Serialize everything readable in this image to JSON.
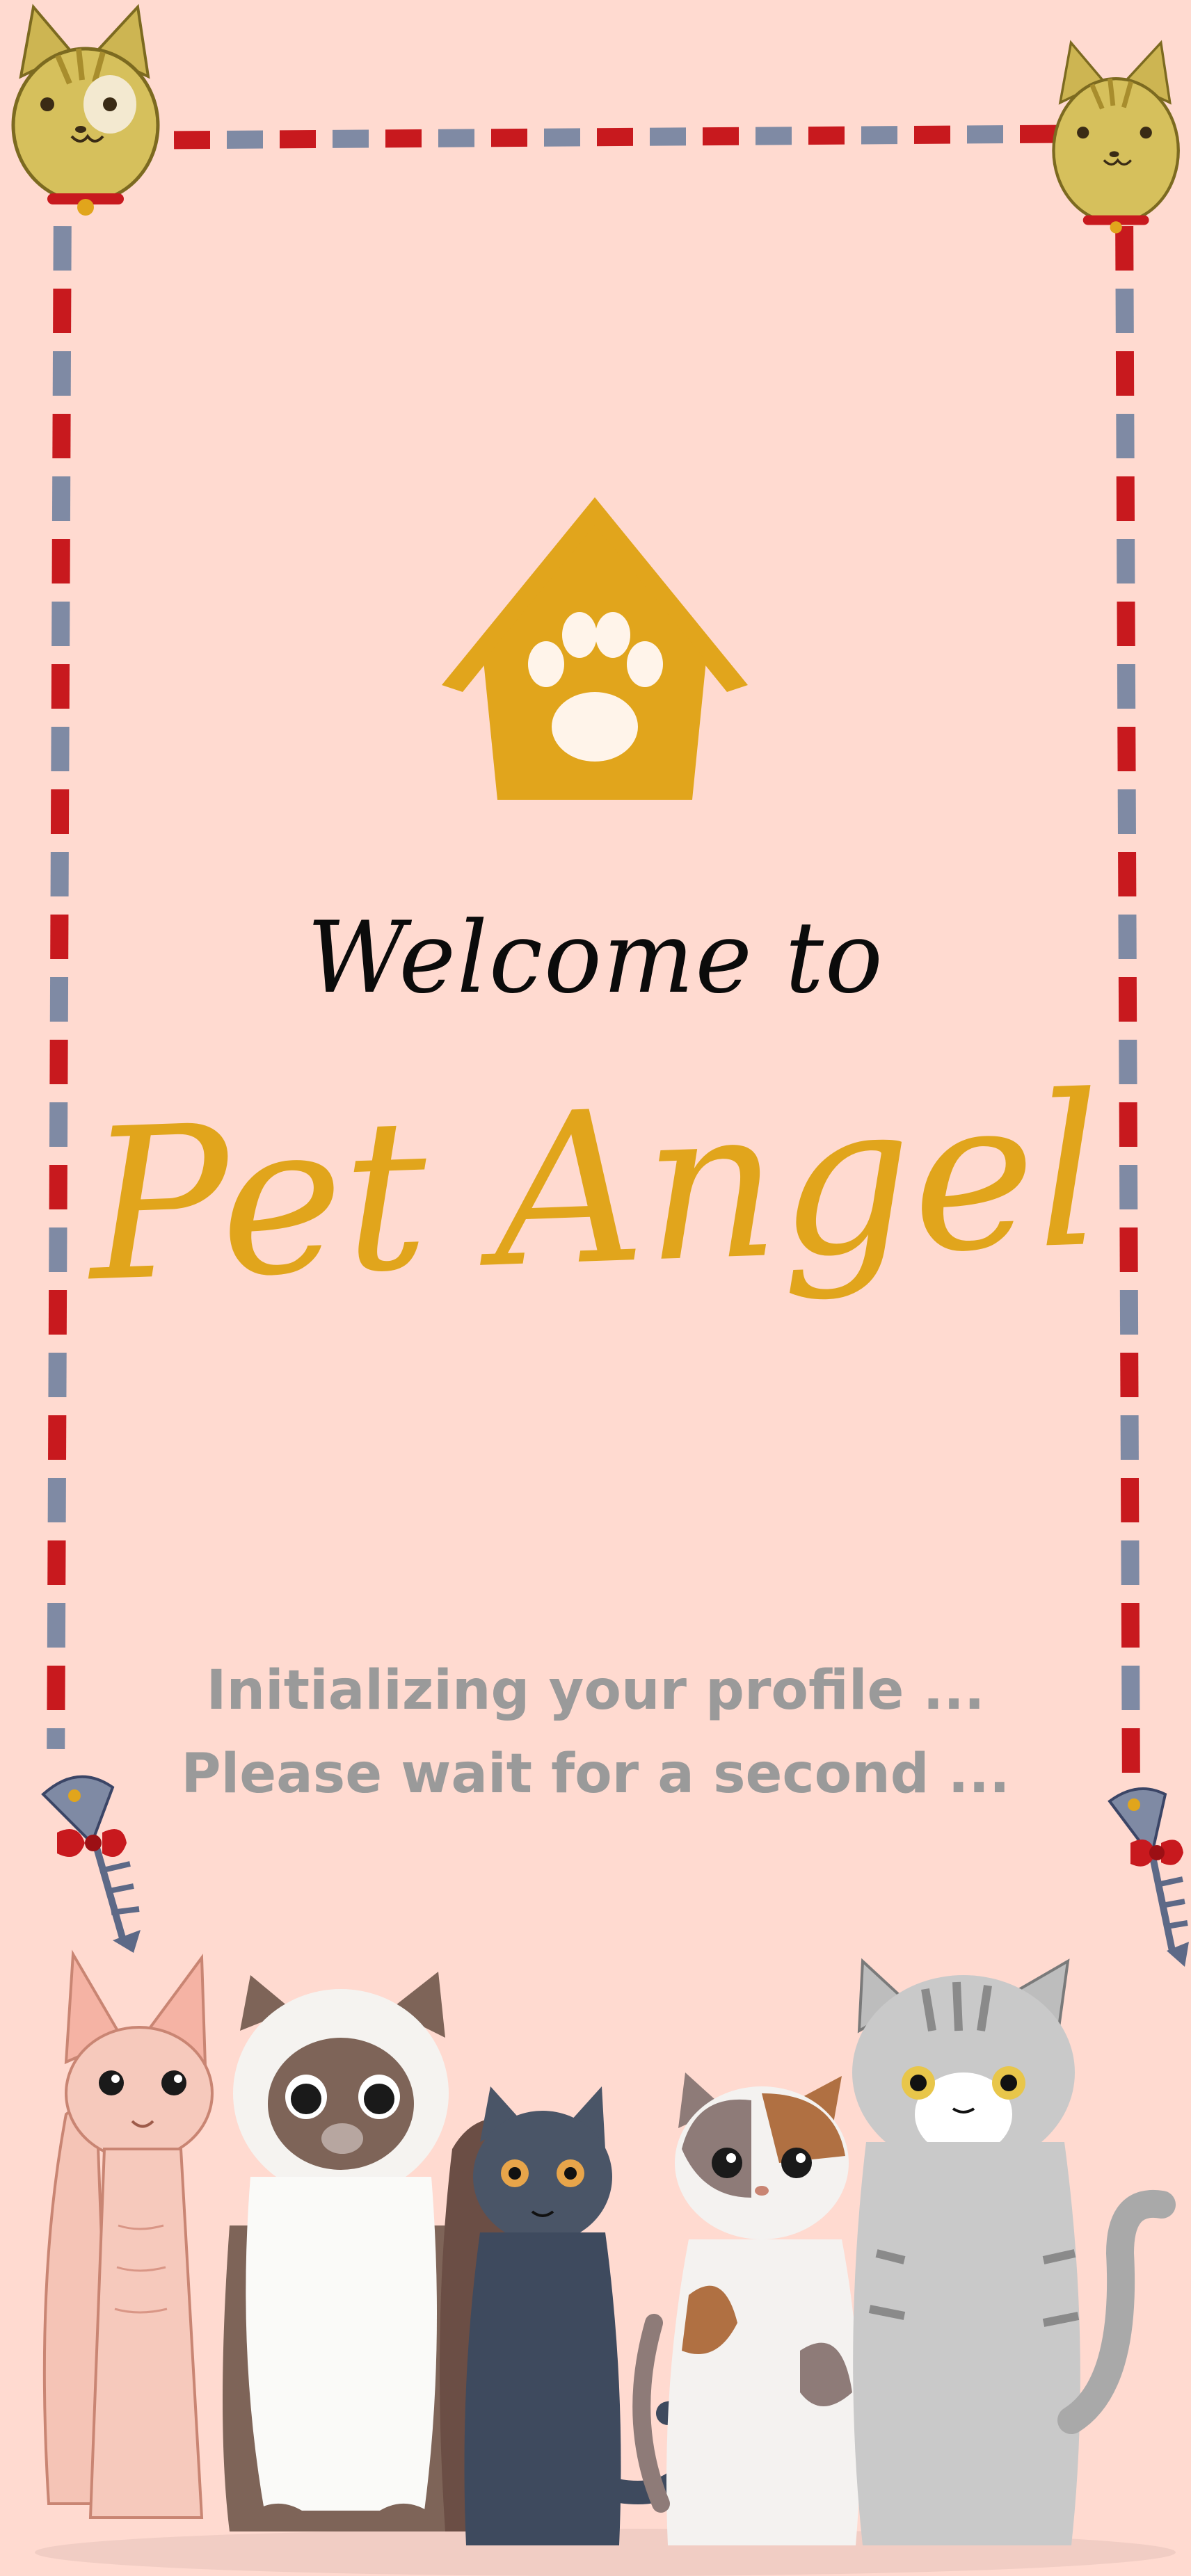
{
  "welcome": {
    "greeting": "Welcome to",
    "brand": "Pet Angel"
  },
  "loading": {
    "line1": "Initializing your profile ...",
    "line2": "Please wait for a second ..."
  },
  "colors": {
    "background": "#FFDAD0",
    "accent": "#E1A51C",
    "frame_red": "#C8191E",
    "frame_blue": "#7F8AA4",
    "status_text": "#9A9A9A"
  },
  "icons": {
    "logo": "doghouse-paw-icon",
    "corner": "cat-head-icon",
    "fish": "fishbone-bow-icon"
  }
}
